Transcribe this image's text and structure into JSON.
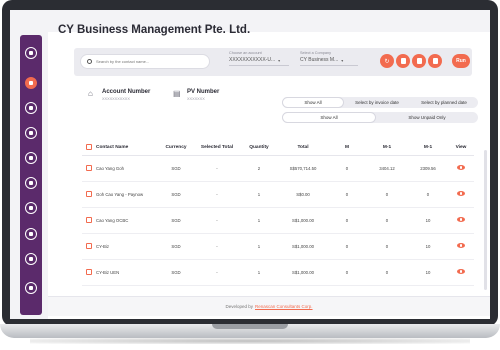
{
  "app": {
    "title": "CY Business Management Pte. Ltd."
  },
  "sidebar": {
    "items": [
      {
        "icon": "logo-icon"
      },
      {
        "icon": "home-icon",
        "active": true
      },
      {
        "icon": "list-icon"
      },
      {
        "icon": "document-icon"
      },
      {
        "icon": "settings-icon"
      },
      {
        "icon": "report-icon"
      },
      {
        "icon": "block-icon"
      },
      {
        "icon": "more-icon"
      },
      {
        "icon": "gear-icon"
      },
      {
        "icon": "logout-icon"
      }
    ]
  },
  "filters": {
    "search_placeholder": "Search by the contact name...",
    "account_label": "Choose an account",
    "account_value": "XXXXXXXXXXX-U...",
    "company_label": "Select a Company",
    "company_value": "CY Business M...",
    "run_label": "Run"
  },
  "accounts": {
    "account_number_label": "Account Number",
    "account_number_value": "XXXXXXXXXXX",
    "pv_number_label": "PV Number",
    "pv_number_value": "XXXXXXX"
  },
  "view_toggle_1": {
    "options": [
      "Show All",
      "Select by invoice date",
      "Select by planned date"
    ],
    "selected": "Show All"
  },
  "view_toggle_2": {
    "options": [
      "Show All",
      "Show Unpaid Only"
    ],
    "selected": "Show All"
  },
  "table": {
    "headers": [
      "Contact Name",
      "Currency",
      "Selected Total",
      "Quantity",
      "Total",
      "M",
      "M-1",
      "M-1",
      "View"
    ],
    "rows": [
      {
        "name": "Cao Yang Goh",
        "currency": "SGD",
        "selected": "-",
        "qty": "2",
        "total": "S$570,714.50",
        "m": "0",
        "m1": "3404.12",
        "m2": "2309.56"
      },
      {
        "name": "Goh Cao Yang - Paynow",
        "currency": "SGD",
        "selected": "-",
        "qty": "1",
        "total": "S$0.00",
        "m": "0",
        "m1": "0",
        "m2": "0"
      },
      {
        "name": "Cao Yang OCBC",
        "currency": "SGD",
        "selected": "-",
        "qty": "1",
        "total": "S$1,000.00",
        "m": "0",
        "m1": "0",
        "m2": "10"
      },
      {
        "name": "CY-Biz",
        "currency": "SGD",
        "selected": "-",
        "qty": "1",
        "total": "S$1,000.00",
        "m": "0",
        "m1": "0",
        "m2": "10"
      },
      {
        "name": "CY-Biz UEN",
        "currency": "SGD",
        "selected": "-",
        "qty": "1",
        "total": "S$1,000.00",
        "m": "0",
        "m1": "0",
        "m2": "10"
      }
    ]
  },
  "footer": {
    "text": "Developed by",
    "link": "Renascan Consultants Corp."
  },
  "colors": {
    "accent": "#f26b4f",
    "sidebar": "#5b2a6b"
  }
}
